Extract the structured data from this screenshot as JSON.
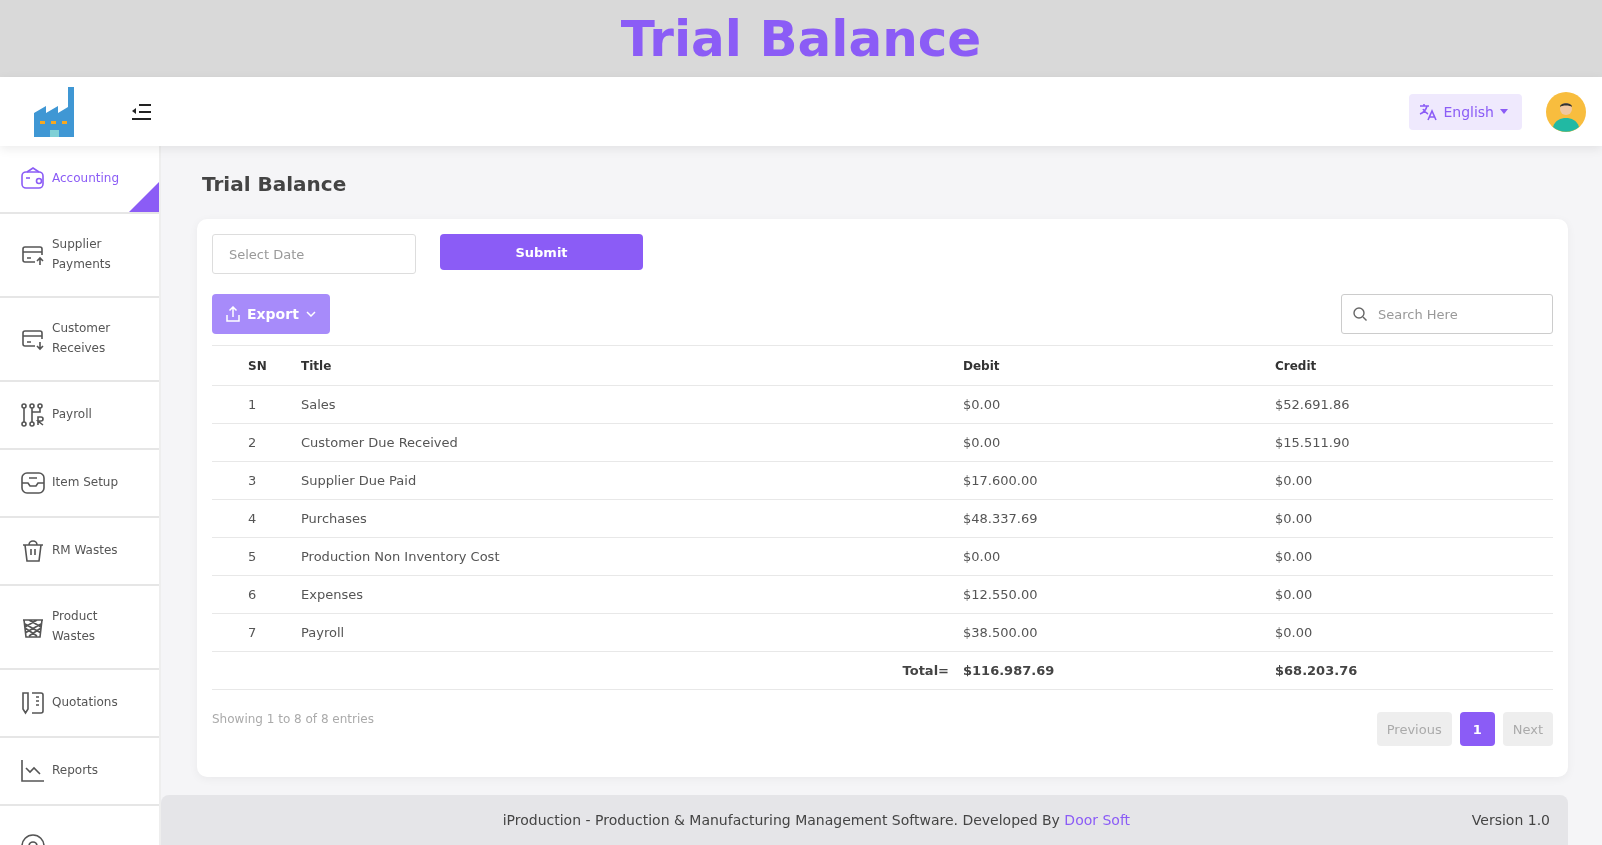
{
  "banner": {
    "title": "Trial Balance"
  },
  "topbar": {
    "language": "English"
  },
  "sidebar": {
    "items": [
      {
        "label": "Accounting",
        "selected": true
      },
      {
        "label": "Supplier Payments",
        "selected": false
      },
      {
        "label": "Customer Receives",
        "selected": false
      },
      {
        "label": "Payroll",
        "selected": false
      },
      {
        "label": "Item Setup",
        "selected": false
      },
      {
        "label": "RM Wastes",
        "selected": false
      },
      {
        "label": "Product Wastes",
        "selected": false
      },
      {
        "label": "Quotations",
        "selected": false
      },
      {
        "label": "Reports",
        "selected": false
      }
    ]
  },
  "page": {
    "title": "Trial Balance"
  },
  "filter": {
    "date_placeholder": "Select Date",
    "submit": "Submit"
  },
  "toolbar": {
    "export": "Export",
    "search_placeholder": "Search Here"
  },
  "table": {
    "columns": [
      "SN",
      "Title",
      "Debit",
      "Credit"
    ],
    "rows": [
      [
        "1",
        "Sales",
        "$0.00",
        "$52.691.86"
      ],
      [
        "2",
        "Customer Due Received",
        "$0.00",
        "$15.511.90"
      ],
      [
        "3",
        "Supplier Due Paid",
        "$17.600.00",
        "$0.00"
      ],
      [
        "4",
        "Purchases",
        "$48.337.69",
        "$0.00"
      ],
      [
        "5",
        "Production Non Inventory Cost",
        "$0.00",
        "$0.00"
      ],
      [
        "6",
        "Expenses",
        "$12.550.00",
        "$0.00"
      ],
      [
        "7",
        "Payroll",
        "$38.500.00",
        "$0.00"
      ]
    ],
    "total": {
      "label": "Total=",
      "debit": "$116.987.69",
      "credit": "$68.203.76"
    }
  },
  "info": "Showing 1 to 8 of 8 entries",
  "pagination": {
    "previous": {
      "label": "Previous",
      "disabled": true
    },
    "pages": [
      {
        "label": "1",
        "selected": true
      }
    ],
    "next": {
      "label": "Next",
      "disabled": true
    }
  },
  "footer": {
    "text": "iProduction - Production & Manufacturing Management Software. Developed By ",
    "link": "Door Soft",
    "version": "Version 1.0"
  }
}
